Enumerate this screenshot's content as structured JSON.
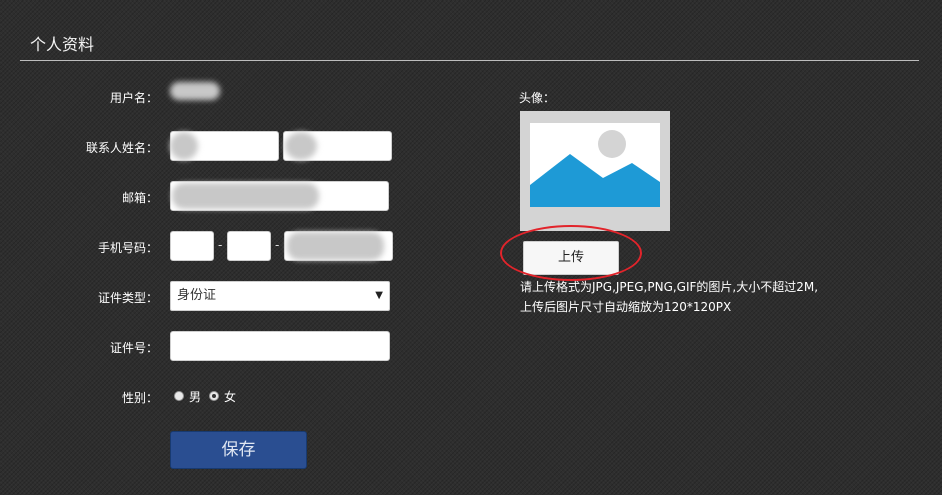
{
  "page": {
    "title": "个人资料"
  },
  "form": {
    "username_label": "用户名：",
    "contact_name_label": "联系人姓名：",
    "email_label": "邮箱：",
    "mobile_label": "手机号码：",
    "mobile_separator": "-",
    "id_type_label": "证件类型：",
    "id_type_value": "身份证",
    "id_number_label": "证件号：",
    "gender_label": "性别：",
    "gender_options": [
      "男",
      "女"
    ],
    "gender_selected": "女",
    "save_label": "保存"
  },
  "avatar": {
    "label": "头像：",
    "upload_label": "上传",
    "hint_line1": "请上传格式为JPG,JPEG,PNG,GIF的图片,大小不超过2M,",
    "hint_line2": "上传后图片尺寸自动缩放为120*120PX",
    "colors": {
      "sky": "#ffffff",
      "mountain": "#1e9ad6",
      "sun": "#d4d4d4",
      "frame": "#d4d4d4"
    }
  },
  "annotation": {
    "color": "#e2242b"
  }
}
